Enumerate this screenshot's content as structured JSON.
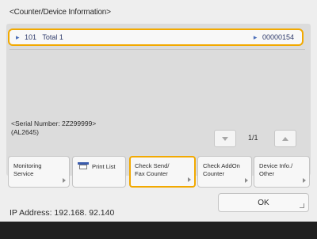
{
  "screen_title": "<Counter/Device Information>",
  "counter": {
    "number": "101",
    "name": "Total 1",
    "value": "00000154"
  },
  "serial_label": "<Serial Number: 2Z299999>",
  "serial_code": "(AL2645)",
  "pagination": {
    "current": "1",
    "total": "1",
    "display": "1/1"
  },
  "buttons": {
    "monitoring": "Monitoring\nService",
    "print_list": "Print List",
    "check_send_fax": "Check Send/\nFax Counter",
    "check_addon": "Check AddOn\nCounter",
    "device_info": "Device Info./\nOther"
  },
  "ip_address": "IP Address: 192.168. 92.140",
  "ok_label": "OK",
  "colors": {
    "highlight": "#f2a900",
    "accent": "#3b5cad"
  },
  "icons": [
    "printer-icon",
    "caret-right-icon",
    "arrow-down-icon",
    "arrow-up-icon",
    "corner-icon"
  ]
}
